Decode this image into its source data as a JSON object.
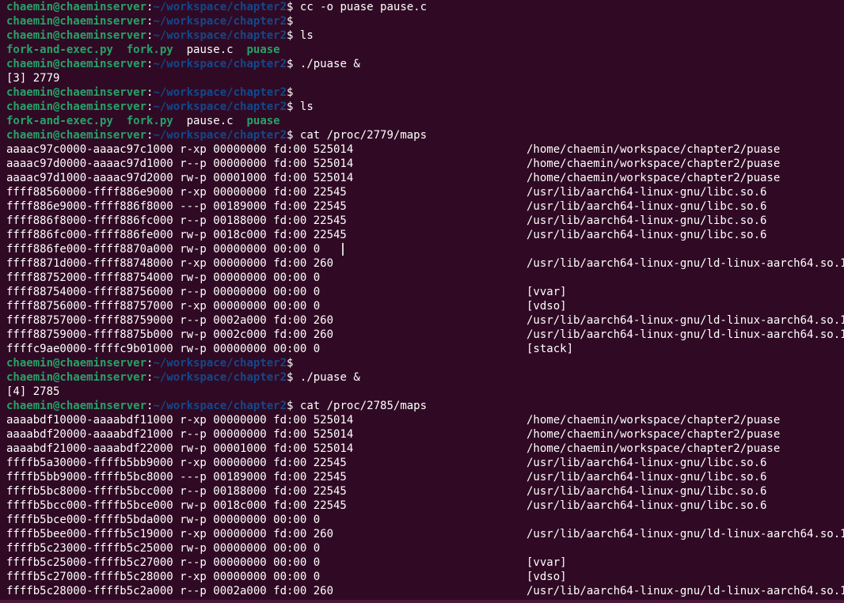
{
  "prompt": {
    "user_host": "chaemin@chaeminserver",
    "path": "~/workspace/chapter2",
    "symbol": "$"
  },
  "lines": [
    {
      "kind": "prompt",
      "cmd": "cc -o puase pause.c"
    },
    {
      "kind": "prompt",
      "cmd": ""
    },
    {
      "kind": "prompt",
      "cmd": "ls"
    },
    {
      "kind": "ls",
      "items": [
        {
          "name": "fork-and-exec.py",
          "exe": true
        },
        {
          "name": "fork.py",
          "exe": true
        },
        {
          "name": "pause.c",
          "exe": false
        },
        {
          "name": "puase",
          "exe": true
        }
      ]
    },
    {
      "kind": "prompt",
      "cmd": "./puase &"
    },
    {
      "kind": "out",
      "text": "[3] 2779"
    },
    {
      "kind": "prompt",
      "cmd": ""
    },
    {
      "kind": "prompt",
      "cmd": "ls"
    },
    {
      "kind": "ls",
      "items": [
        {
          "name": "fork-and-exec.py",
          "exe": true
        },
        {
          "name": "fork.py",
          "exe": true
        },
        {
          "name": "pause.c",
          "exe": false
        },
        {
          "name": "puase",
          "exe": true
        }
      ]
    },
    {
      "kind": "prompt",
      "cmd": "cat /proc/2779/maps"
    },
    {
      "kind": "map",
      "range": "aaaac97c0000-aaaac97c1000",
      "perms": "r-xp",
      "offset": "00000000",
      "dev": "fd:00",
      "inode": "525014",
      "path": "/home/chaemin/workspace/chapter2/puase"
    },
    {
      "kind": "map",
      "range": "aaaac97d0000-aaaac97d1000",
      "perms": "r--p",
      "offset": "00000000",
      "dev": "fd:00",
      "inode": "525014",
      "path": "/home/chaemin/workspace/chapter2/puase"
    },
    {
      "kind": "map",
      "range": "aaaac97d1000-aaaac97d2000",
      "perms": "rw-p",
      "offset": "00001000",
      "dev": "fd:00",
      "inode": "525014",
      "path": "/home/chaemin/workspace/chapter2/puase"
    },
    {
      "kind": "map",
      "range": "ffff88560000-ffff886e9000",
      "perms": "r-xp",
      "offset": "00000000",
      "dev": "fd:00",
      "inode": "22545",
      "path": "/usr/lib/aarch64-linux-gnu/libc.so.6"
    },
    {
      "kind": "map",
      "range": "ffff886e9000-ffff886f8000",
      "perms": "---p",
      "offset": "00189000",
      "dev": "fd:00",
      "inode": "22545",
      "path": "/usr/lib/aarch64-linux-gnu/libc.so.6"
    },
    {
      "kind": "map",
      "range": "ffff886f8000-ffff886fc000",
      "perms": "r--p",
      "offset": "00188000",
      "dev": "fd:00",
      "inode": "22545",
      "path": "/usr/lib/aarch64-linux-gnu/libc.so.6"
    },
    {
      "kind": "map",
      "range": "ffff886fc000-ffff886fe000",
      "perms": "rw-p",
      "offset": "0018c000",
      "dev": "fd:00",
      "inode": "22545",
      "path": "/usr/lib/aarch64-linux-gnu/libc.so.6"
    },
    {
      "kind": "map",
      "range": "ffff886fe000-ffff8870a000",
      "perms": "rw-p",
      "offset": "00000000",
      "dev": "00:00",
      "inode": "0",
      "path": ""
    },
    {
      "kind": "map",
      "range": "ffff8871d000-ffff88748000",
      "perms": "r-xp",
      "offset": "00000000",
      "dev": "fd:00",
      "inode": "260",
      "path": "/usr/lib/aarch64-linux-gnu/ld-linux-aarch64.so.1"
    },
    {
      "kind": "map",
      "range": "ffff88752000-ffff88754000",
      "perms": "rw-p",
      "offset": "00000000",
      "dev": "00:00",
      "inode": "0",
      "path": ""
    },
    {
      "kind": "map",
      "range": "ffff88754000-ffff88756000",
      "perms": "r--p",
      "offset": "00000000",
      "dev": "00:00",
      "inode": "0",
      "path": "[vvar]"
    },
    {
      "kind": "map",
      "range": "ffff88756000-ffff88757000",
      "perms": "r-xp",
      "offset": "00000000",
      "dev": "00:00",
      "inode": "0",
      "path": "[vdso]"
    },
    {
      "kind": "map",
      "range": "ffff88757000-ffff88759000",
      "perms": "r--p",
      "offset": "0002a000",
      "dev": "fd:00",
      "inode": "260",
      "path": "/usr/lib/aarch64-linux-gnu/ld-linux-aarch64.so.1"
    },
    {
      "kind": "map",
      "range": "ffff88759000-ffff8875b000",
      "perms": "rw-p",
      "offset": "0002c000",
      "dev": "fd:00",
      "inode": "260",
      "path": "/usr/lib/aarch64-linux-gnu/ld-linux-aarch64.so.1"
    },
    {
      "kind": "map",
      "range": "ffffc9ae0000-ffffc9b01000",
      "perms": "rw-p",
      "offset": "00000000",
      "dev": "00:00",
      "inode": "0",
      "path": "[stack]"
    },
    {
      "kind": "prompt",
      "cmd": ""
    },
    {
      "kind": "prompt",
      "cmd": "./puase &"
    },
    {
      "kind": "out",
      "text": "[4] 2785"
    },
    {
      "kind": "prompt",
      "cmd": "cat /proc/2785/maps"
    },
    {
      "kind": "map",
      "range": "aaaabdf10000-aaaabdf11000",
      "perms": "r-xp",
      "offset": "00000000",
      "dev": "fd:00",
      "inode": "525014",
      "path": "/home/chaemin/workspace/chapter2/puase"
    },
    {
      "kind": "map",
      "range": "aaaabdf20000-aaaabdf21000",
      "perms": "r--p",
      "offset": "00000000",
      "dev": "fd:00",
      "inode": "525014",
      "path": "/home/chaemin/workspace/chapter2/puase"
    },
    {
      "kind": "map",
      "range": "aaaabdf21000-aaaabdf22000",
      "perms": "rw-p",
      "offset": "00001000",
      "dev": "fd:00",
      "inode": "525014",
      "path": "/home/chaemin/workspace/chapter2/puase"
    },
    {
      "kind": "map",
      "range": "ffffb5a30000-ffffb5bb9000",
      "perms": "r-xp",
      "offset": "00000000",
      "dev": "fd:00",
      "inode": "22545",
      "path": "/usr/lib/aarch64-linux-gnu/libc.so.6"
    },
    {
      "kind": "map",
      "range": "ffffb5bb9000-ffffb5bc8000",
      "perms": "---p",
      "offset": "00189000",
      "dev": "fd:00",
      "inode": "22545",
      "path": "/usr/lib/aarch64-linux-gnu/libc.so.6"
    },
    {
      "kind": "map",
      "range": "ffffb5bc8000-ffffb5bcc000",
      "perms": "r--p",
      "offset": "00188000",
      "dev": "fd:00",
      "inode": "22545",
      "path": "/usr/lib/aarch64-linux-gnu/libc.so.6"
    },
    {
      "kind": "map",
      "range": "ffffb5bcc000-ffffb5bce000",
      "perms": "rw-p",
      "offset": "0018c000",
      "dev": "fd:00",
      "inode": "22545",
      "path": "/usr/lib/aarch64-linux-gnu/libc.so.6"
    },
    {
      "kind": "map",
      "range": "ffffb5bce000-ffffb5bda000",
      "perms": "rw-p",
      "offset": "00000000",
      "dev": "00:00",
      "inode": "0",
      "path": ""
    },
    {
      "kind": "map",
      "range": "ffffb5bee000-ffffb5c19000",
      "perms": "r-xp",
      "offset": "00000000",
      "dev": "fd:00",
      "inode": "260",
      "path": "/usr/lib/aarch64-linux-gnu/ld-linux-aarch64.so.1"
    },
    {
      "kind": "map",
      "range": "ffffb5c23000-ffffb5c25000",
      "perms": "rw-p",
      "offset": "00000000",
      "dev": "00:00",
      "inode": "0",
      "path": ""
    },
    {
      "kind": "map",
      "range": "ffffb5c25000-ffffb5c27000",
      "perms": "r--p",
      "offset": "00000000",
      "dev": "00:00",
      "inode": "0",
      "path": "[vvar]"
    },
    {
      "kind": "map",
      "range": "ffffb5c27000-ffffb5c28000",
      "perms": "r-xp",
      "offset": "00000000",
      "dev": "00:00",
      "inode": "0",
      "path": "[vdso]"
    },
    {
      "kind": "map",
      "range": "ffffb5c28000-ffffb5c2a000",
      "perms": "r--p",
      "offset": "0002a000",
      "dev": "fd:00",
      "inode": "260",
      "path": "/usr/lib/aarch64-linux-gnu/ld-linux-aarch64.so.1"
    }
  ]
}
